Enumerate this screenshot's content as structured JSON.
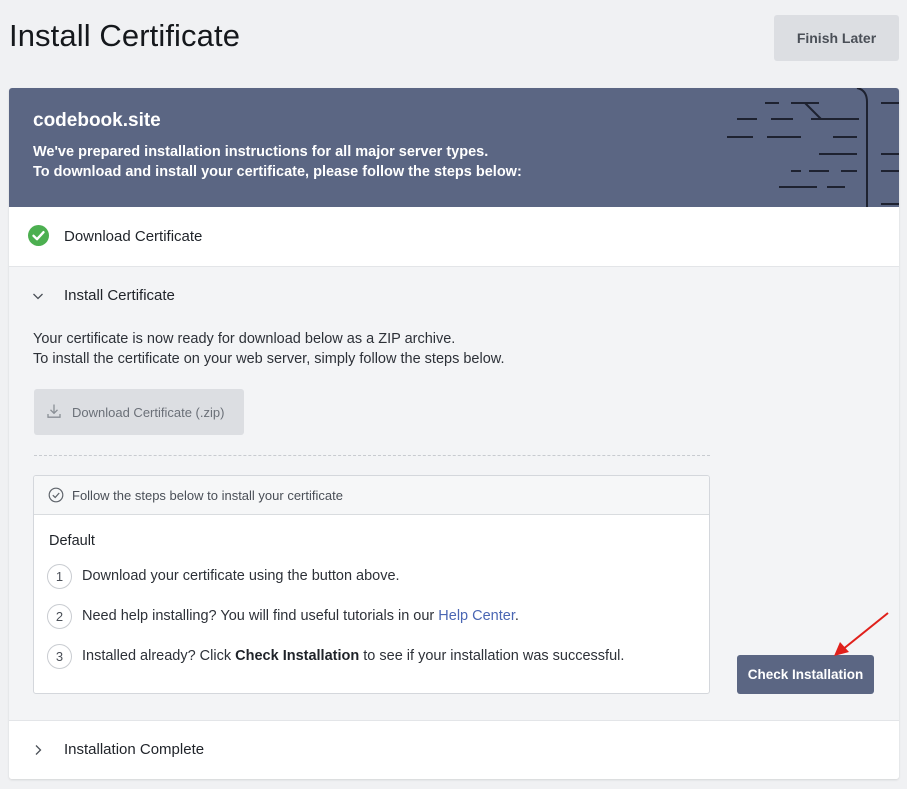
{
  "page": {
    "title": "Install Certificate",
    "finish_later_label": "Finish Later"
  },
  "banner": {
    "domain": "codebook.site",
    "line1": "We've prepared installation instructions for all major server types.",
    "line2": "To download and install your certificate, please follow the steps below:",
    "background_color": "#5b6683"
  },
  "sections": {
    "download": {
      "label": "Download Certificate",
      "status": "complete",
      "status_icon": "check-circle-icon",
      "accent": "#4caf50"
    },
    "install": {
      "label": "Install Certificate",
      "expanded": true,
      "intro_line1": "Your certificate is now ready for download below as a ZIP archive.",
      "intro_line2": "To install the certificate on your web server, simply follow the steps below.",
      "download_button_label": "Download Certificate (.zip)",
      "steps_header": "Follow the steps below to install your certificate",
      "server_type": "Default",
      "steps": [
        {
          "num": "1",
          "text": "Download your certificate using the button above."
        },
        {
          "num": "2",
          "text_before": "Need help installing? You will find useful tutorials in our ",
          "link": "Help Center",
          "text_after": "."
        },
        {
          "num": "3",
          "text_before": "Installed already? Click ",
          "bold": "Check Installation",
          "text_after": " to see if your installation was successful."
        }
      ],
      "check_installation_label": "Check Installation"
    },
    "complete": {
      "label": "Installation Complete",
      "expanded": false
    }
  },
  "annotation": {
    "color": "#e0201b",
    "icon": "red-arrow"
  }
}
